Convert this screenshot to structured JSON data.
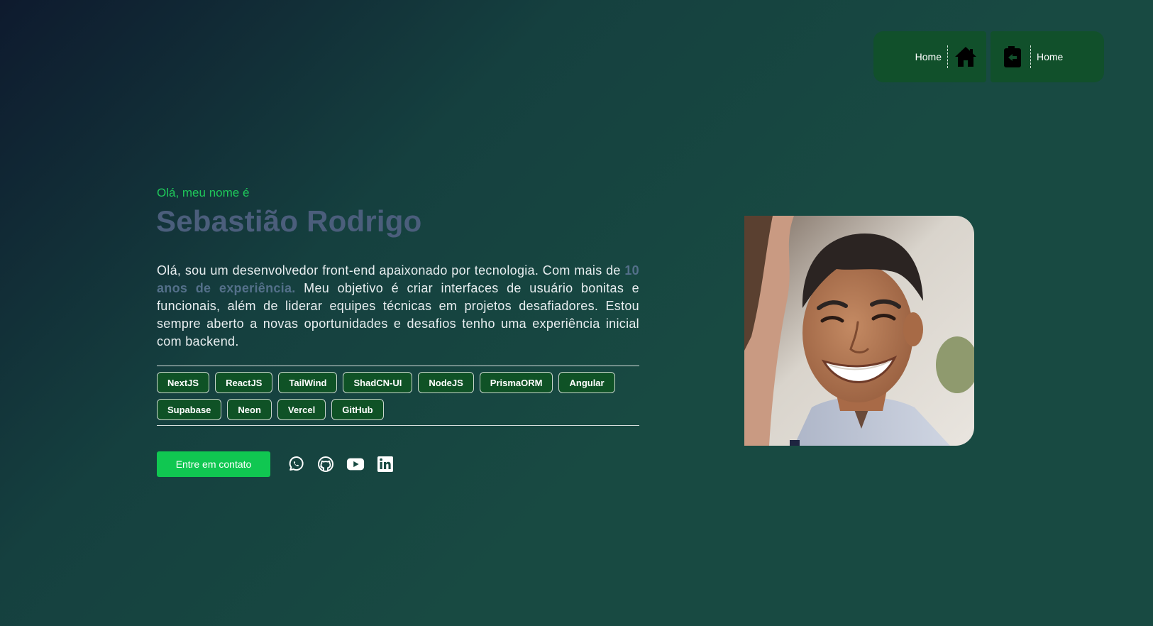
{
  "nav": {
    "home_label": "Home",
    "home_icon": "home-icon",
    "back_icon": "back-icon",
    "back_label": "Home"
  },
  "hero": {
    "greeting": "Olá, meu nome é",
    "name": "Sebastião Rodrigo",
    "bio_part1": "Olá, sou um desenvolvedor front-end apaixonado por tecnologia. Com mais de ",
    "bio_highlight": "10 anos de experiência.",
    "bio_part2": " Meu objetivo é criar interfaces de usuário bonitas e funcionais, além de liderar equipes técnicas em projetos desafiadores. Estou sempre aberto a novas oportunidades e desafios tenho uma experiência inicial com backend."
  },
  "tags": [
    "NextJS",
    "ReactJS",
    "TailWind",
    "ShadCN-UI",
    "NodeJS",
    "PrismaORM",
    "Angular",
    "Supabase",
    "Neon",
    "Vercel",
    "GitHub"
  ],
  "cta": {
    "label": "Entre em contato"
  },
  "socials": [
    "whatsapp-icon",
    "github-icon",
    "youtube-icon",
    "linkedin-icon"
  ],
  "colors": {
    "accent": "#10c751",
    "greeting": "#1fc85a",
    "name": "#4b5e7c",
    "tag_bg": "#0f5226",
    "nav_bg": "#11502b"
  }
}
